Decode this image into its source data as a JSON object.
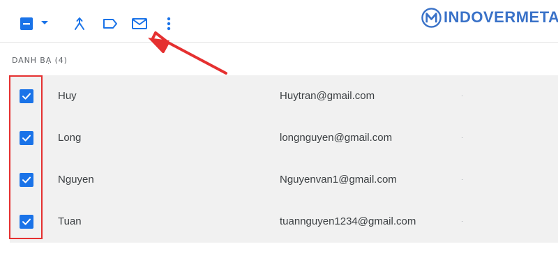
{
  "brand": {
    "logo_text": "INDOVERMETAL",
    "logo_color": "#3a72c8"
  },
  "toolbar": {
    "select_all_icon": "indeterminate-checkbox-icon",
    "select_menu_icon": "caret-down-icon",
    "merge_icon": "merge-icon",
    "label_icon": "label-icon",
    "email_icon": "envelope-icon",
    "more_icon": "more-vertical-icon"
  },
  "section": {
    "label": "DANH BẠ (4)"
  },
  "contacts": [
    {
      "name": "Huy",
      "email": "Huytran@gmail.com",
      "checked": true
    },
    {
      "name": "Long",
      "email": "longnguyen@gmail.com",
      "checked": true
    },
    {
      "name": "Nguyen",
      "email": "Nguyenvan1@gmail.com",
      "checked": true
    },
    {
      "name": "Tuan",
      "email": "tuannguyen1234@gmail.com",
      "checked": true
    }
  ],
  "colors": {
    "accent": "#1a73e8",
    "annotation": "#e53030",
    "row_background": "#f1f1f1"
  }
}
